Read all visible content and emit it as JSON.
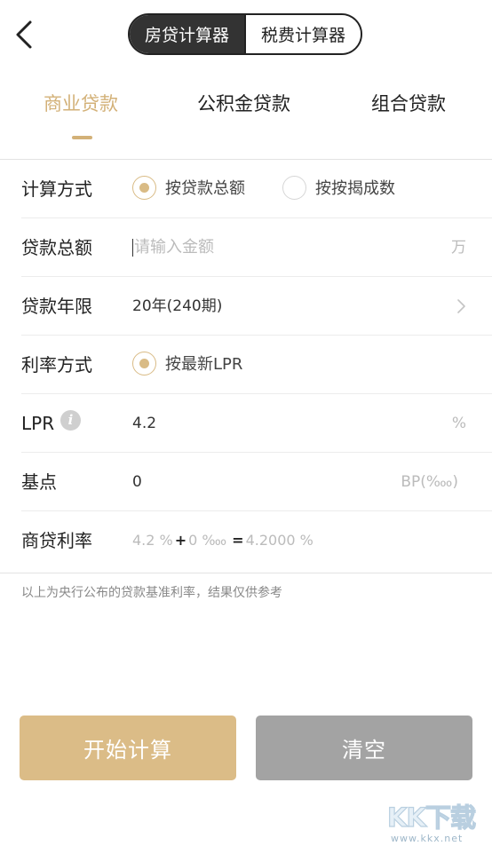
{
  "header": {
    "back_icon": "chevron-left-icon",
    "segments": [
      {
        "label": "房贷计算器",
        "active": true
      },
      {
        "label": "税费计算器",
        "active": false
      }
    ]
  },
  "tabs": [
    {
      "label": "商业贷款",
      "active": true
    },
    {
      "label": "公积金贷款",
      "active": false
    },
    {
      "label": "组合贷款",
      "active": false
    }
  ],
  "form": {
    "calc_method": {
      "label": "计算方式",
      "options": [
        {
          "label": "按贷款总额",
          "selected": true
        },
        {
          "label": "按按揭成数",
          "selected": false
        }
      ]
    },
    "loan_amount": {
      "label": "贷款总额",
      "placeholder": "请输入金额",
      "unit": "万"
    },
    "loan_term": {
      "label": "贷款年限",
      "value": "20年(240期)"
    },
    "rate_method": {
      "label": "利率方式",
      "option": "按最新LPR",
      "selected": true
    },
    "lpr": {
      "label": "LPR",
      "info_icon": "info-icon",
      "value": "4.2",
      "unit": "%"
    },
    "basis_points": {
      "label": "基点",
      "value": "0",
      "unit": "BP(‱)"
    },
    "commercial_rate": {
      "label": "商贷利率",
      "lpr_part": "4.2 %",
      "plus": "+",
      "bp_part": "0 ‱",
      "equals": "=",
      "result": "4.2000 %"
    }
  },
  "note": "以上为央行公布的贷款基准利率，结果仅供参考",
  "buttons": {
    "calculate": "开始计算",
    "clear": "清空"
  },
  "watermark": {
    "brand": "KK下载",
    "url": "www.kkx.net"
  },
  "colors": {
    "accent": "#d3b178",
    "calc_button": "#dbbc87",
    "clear_button": "#a3a3a3",
    "segment_active": "#333333"
  }
}
